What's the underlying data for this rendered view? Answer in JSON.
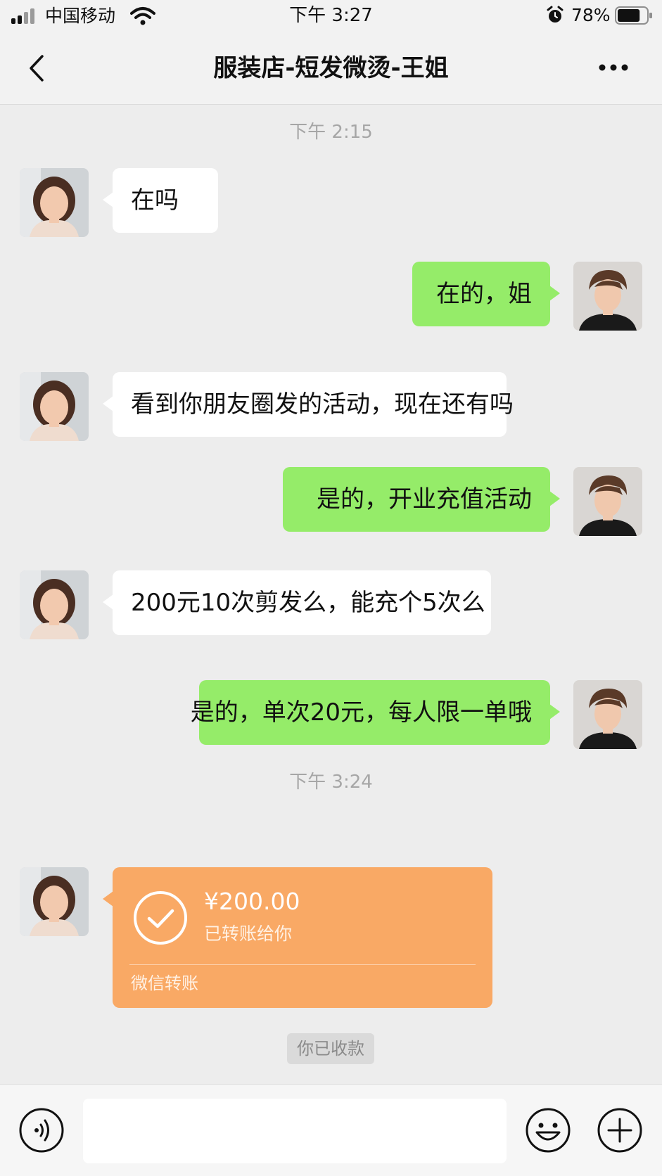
{
  "status_bar": {
    "carrier": "中国移动",
    "time": "下午 3:27",
    "battery_percent": "78%",
    "battery_level": 0.78,
    "icons": [
      "signal-icon",
      "wifi-icon",
      "alarm-icon",
      "battery-icon"
    ]
  },
  "nav": {
    "title": "服装店-短发微烫-王姐",
    "back_icon": "chevron-left-icon",
    "more_icon": "more-icon"
  },
  "chat": {
    "timestamp_1": "下午 2:15",
    "timestamp_2": "下午 3:24",
    "messages": [
      {
        "from": "customer",
        "text": "在吗"
      },
      {
        "from": "me",
        "text": "在的，姐"
      },
      {
        "from": "customer",
        "text": "看到你朋友圈发的活动，现在还有吗"
      },
      {
        "from": "me",
        "text": "是的，开业充值活动"
      },
      {
        "from": "customer",
        "text": "200元10次剪发么，能充个5次么"
      },
      {
        "from": "me",
        "text": "是的，单次20元，每人限一单哦"
      }
    ],
    "transfer": {
      "amount": "¥200.00",
      "status": "已转账给你",
      "source": "微信转账",
      "icon": "check-circle-icon",
      "color": "#f9a965"
    },
    "received_label": "你已收款"
  },
  "input_bar": {
    "placeholder": "",
    "voice_icon": "voice-icon",
    "emoji_icon": "emoji-icon",
    "plus_icon": "plus-circle-icon"
  },
  "colors": {
    "outgoing_bubble": "#95ec69",
    "incoming_bubble": "#ffffff",
    "background": "#ededed"
  }
}
